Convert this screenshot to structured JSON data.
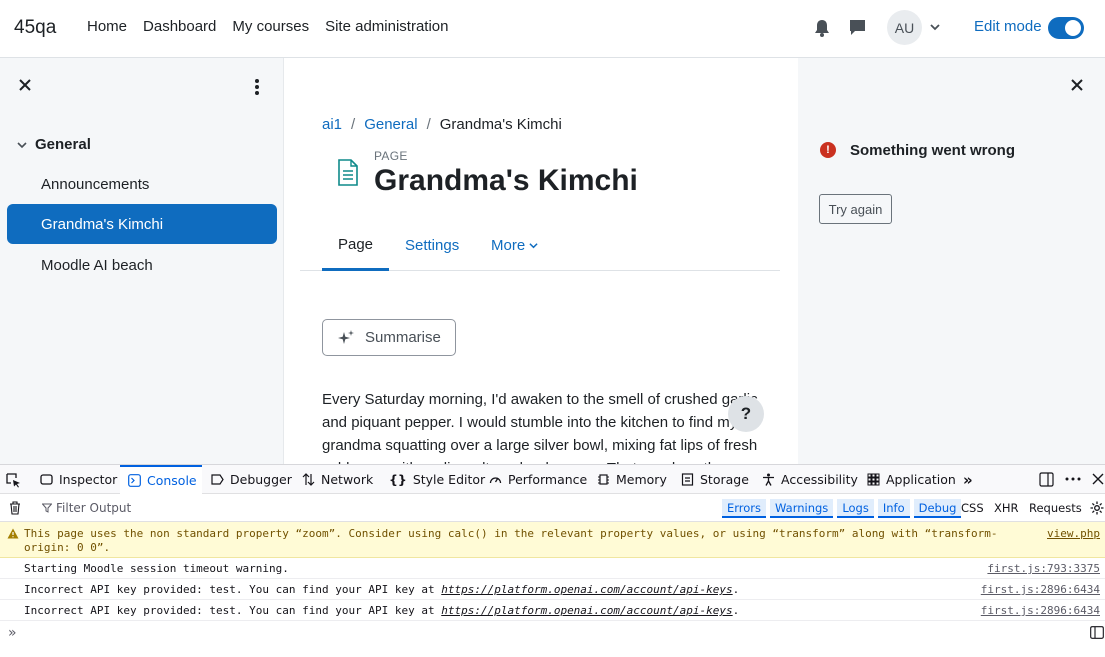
{
  "navbar": {
    "brand": "45qa",
    "links": [
      "Home",
      "Dashboard",
      "My courses",
      "Site administration"
    ],
    "avatar_initials": "AU",
    "edit_mode_label": "Edit mode",
    "edit_mode_on": true
  },
  "course_index": {
    "section": "General",
    "items": [
      "Announcements",
      "Grandma's Kimchi",
      "Moodle AI beach"
    ],
    "active_item": "Grandma's Kimchi"
  },
  "main": {
    "breadcrumb": [
      "ai1",
      "General",
      "Grandma's Kimchi"
    ],
    "kind": "PAGE",
    "title": "Grandma's Kimchi",
    "tabs": [
      "Page",
      "Settings",
      "More"
    ],
    "active_tab": "Page",
    "summarise_label": "Summarise",
    "content": "Every Saturday morning, I'd awaken to the smell of crushed garlic and piquant pepper. I would stumble into the kitchen to find my grandma squatting over a large silver bowl, mixing fat lips of fresh cabbages with garlic, salt, and red pepper. That was how the",
    "help_label": "?"
  },
  "right_drawer": {
    "error_title": "Something went wrong",
    "try_again_label": "Try again"
  },
  "devtools": {
    "tabs": [
      "Inspector",
      "Console",
      "Debugger",
      "Network",
      "Style Editor",
      "Performance",
      "Memory",
      "Storage",
      "Accessibility",
      "Application"
    ],
    "active_tab": "Console",
    "filter_placeholder": "Filter Output",
    "levels": [
      "Errors",
      "Warnings",
      "Logs",
      "Info",
      "Debug"
    ],
    "request_filters": [
      "CSS",
      "XHR",
      "Requests"
    ],
    "messages": [
      {
        "type": "warning",
        "text_line1": "This page uses the non standard property “zoom”. Consider using calc() in the relevant property values, or using “transform” along with “transform-",
        "text_line2": "origin: 0 0”.",
        "source": "view.php"
      },
      {
        "type": "log",
        "text": "Starting Moodle session timeout warning.",
        "source": "first.js:793:3375"
      },
      {
        "type": "log",
        "text_prefix": "Incorrect API key provided: test. You can find your API key at ",
        "url": "https://platform.openai.com/account/api-keys",
        "text_suffix": ".",
        "source": "first.js:2896:6434"
      },
      {
        "type": "log",
        "text_prefix": "Incorrect API key provided: test. You can find your API key at ",
        "url": "https://platform.openai.com/account/api-keys",
        "text_suffix": ".",
        "source": "first.js:2896:6434"
      }
    ],
    "prompt_symbol": "»"
  },
  "colors": {
    "accent": "#0f6cbf",
    "error": "#ca3120",
    "devtools_accent": "#0061e0",
    "warning_bg": "#fffbd6"
  }
}
